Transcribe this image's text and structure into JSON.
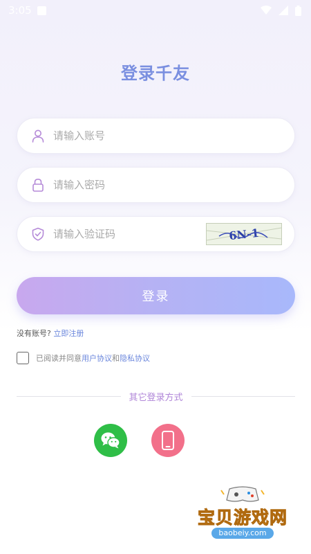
{
  "status_bar": {
    "time": "3:05"
  },
  "page": {
    "title": "登录千友"
  },
  "form": {
    "account_placeholder": "请输入账号",
    "password_placeholder": "请输入密码",
    "captcha_placeholder": "请输入验证码",
    "captcha_text": "6N-1"
  },
  "login_button": {
    "label": "登录"
  },
  "register": {
    "prompt": "没有账号?",
    "link": "立即注册"
  },
  "agreement": {
    "prefix": "已阅读并同意",
    "user_agreement": "用户协议",
    "and": "和",
    "privacy_agreement": "隐私协议",
    "checked": false
  },
  "other_login": {
    "label": "其它登录方式"
  },
  "watermark": {
    "text": "宝贝游戏网",
    "url": "baobeiy.com"
  },
  "colors": {
    "title": "#7a8fe0",
    "accent_link": "#6a86dc",
    "wechat": "#2fbe47",
    "phone": "#f2708a",
    "icon": "#b58ad8"
  }
}
